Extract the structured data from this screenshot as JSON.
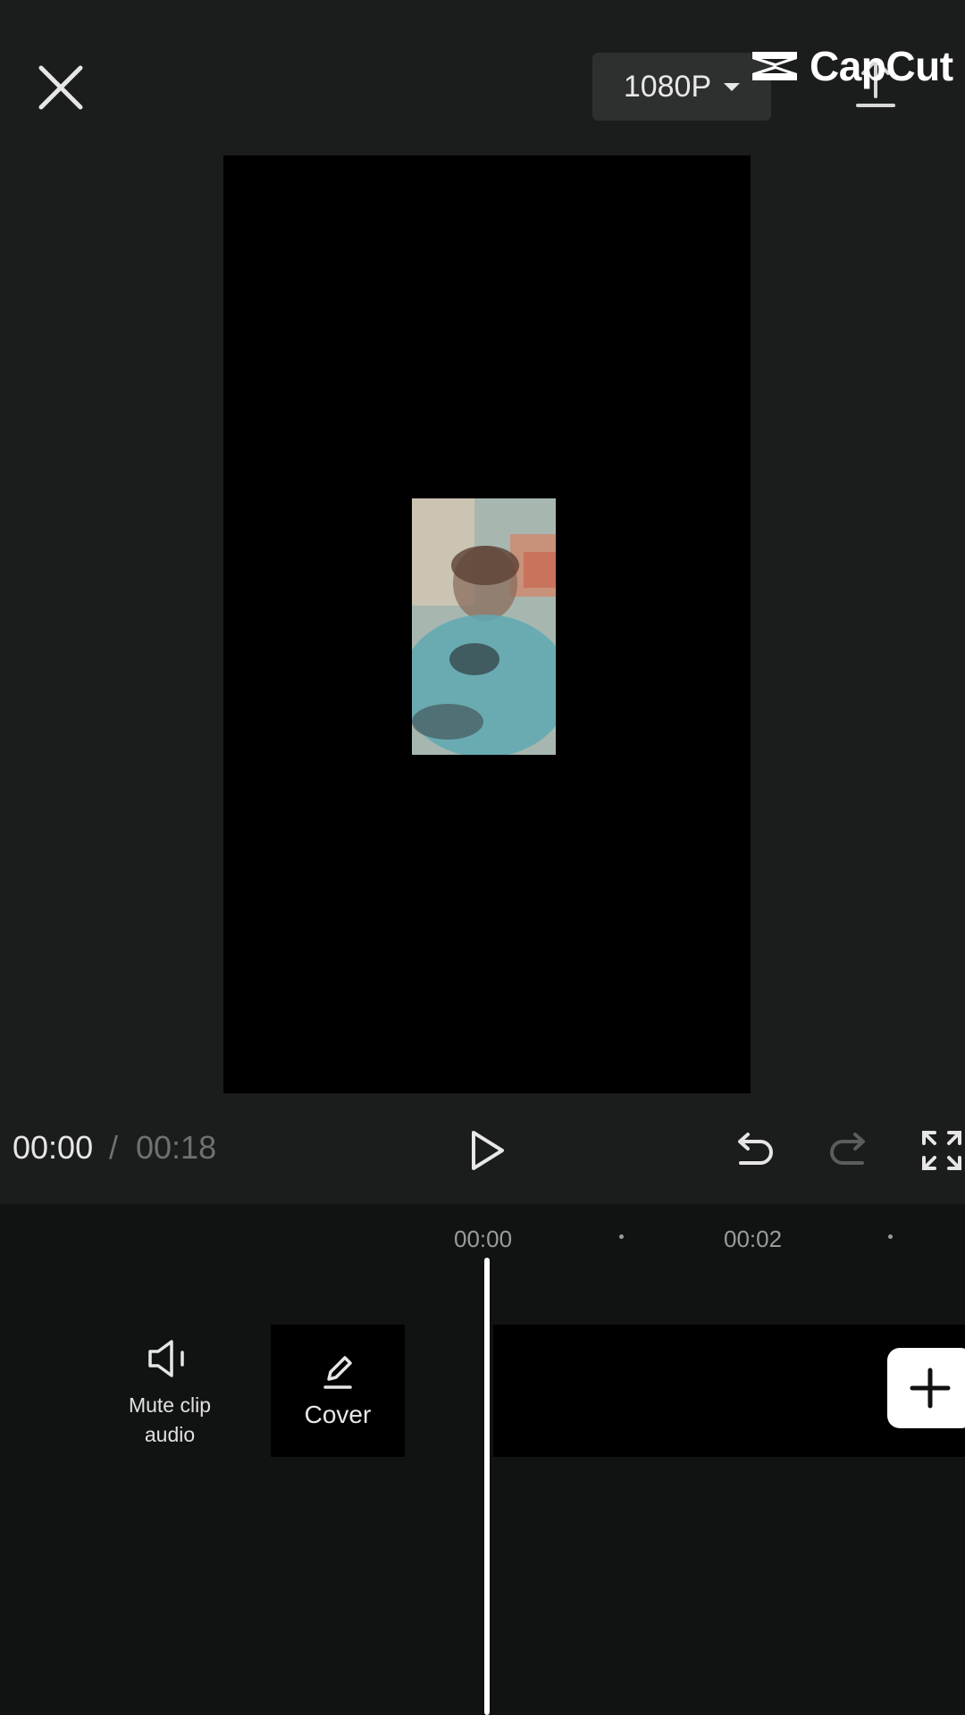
{
  "watermark": {
    "brand": "CapCut",
    "icon": "capcut-logo-icon"
  },
  "topbar": {
    "close_icon": "close-icon",
    "resolution": "1080P",
    "resolution_icon": "caret-down-icon",
    "export_icon": "export-upload-icon"
  },
  "controls": {
    "current_time": "00:00",
    "separator": "/",
    "total_time": "00:18",
    "play_icon": "play-icon",
    "undo_icon": "undo-icon",
    "redo_icon": "redo-icon",
    "fullscreen_icon": "fullscreen-icon"
  },
  "timeline": {
    "ruler": [
      "00:00",
      "00:02"
    ],
    "mute_label": "Mute clip audio",
    "mute_icon": "speaker-icon",
    "cover_label": "Cover",
    "cover_icon": "pencil-icon",
    "add_icon": "plus-icon"
  },
  "colors": {
    "background": "#1b1c1c",
    "timeline_background": "#111312",
    "accent": "#ffffff"
  }
}
